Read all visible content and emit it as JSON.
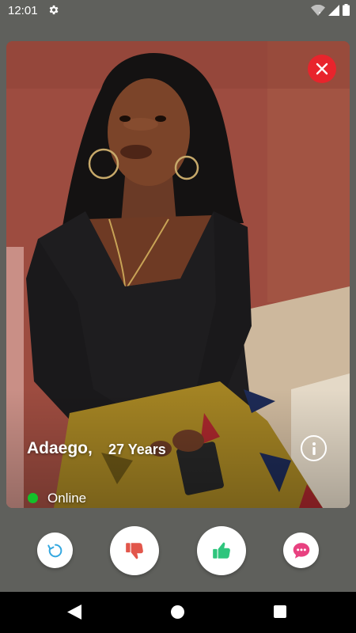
{
  "status_bar": {
    "time": "12:01",
    "icons": [
      "gear-icon",
      "wifi-icon",
      "signal-icon",
      "battery-icon"
    ]
  },
  "profile": {
    "name": "Adaego,",
    "age": "27 Years",
    "status": "Online",
    "status_color": "#13c12a",
    "photo": "profile-photo"
  },
  "actions": [
    {
      "icon": "rewind-icon",
      "color": "#35a8e0"
    },
    {
      "icon": "thumbs-down-icon",
      "color": "#e2564b"
    },
    {
      "icon": "thumbs-up-icon",
      "color": "#2fc57d"
    },
    {
      "icon": "chat-bubble-icon",
      "color": "#e84180"
    }
  ],
  "colors": {
    "background": "#5f605c",
    "close_button": "#e8242c",
    "nav_bar": "#000000"
  },
  "navigation": [
    "back-icon",
    "home-icon",
    "recents-icon"
  ]
}
